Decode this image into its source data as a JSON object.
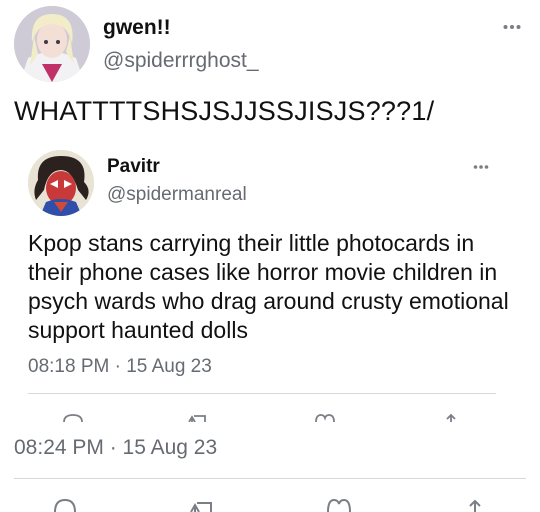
{
  "tweet": {
    "author": {
      "display_name": "gwen!!",
      "handle": "@spiderrrghost_"
    },
    "text": "WHATTTTSHSJSJJSSJISJS???1/",
    "timestamp": "08:24 PM · 15 Aug 23",
    "more_icon": "more-dots-icon",
    "actions": [
      "reply-icon",
      "retweet-icon",
      "like-icon",
      "share-icon"
    ]
  },
  "quoted_tweet": {
    "author": {
      "display_name": "Pavitr",
      "handle": "@spidermanreal"
    },
    "text": "Kpop stans carrying their little photocards in their phone cases like horror movie children in psych wards who drag around crusty emotional support haunted dolls",
    "timestamp": "08:18 PM · 15 Aug 23",
    "more_icon": "more-dots-icon",
    "actions": [
      "reply-icon",
      "retweet-icon",
      "like-icon",
      "share-icon"
    ]
  },
  "colors": {
    "text": "#111111",
    "secondary_text": "#666b72",
    "divider": "#d6d8db",
    "background": "#ffffff"
  }
}
